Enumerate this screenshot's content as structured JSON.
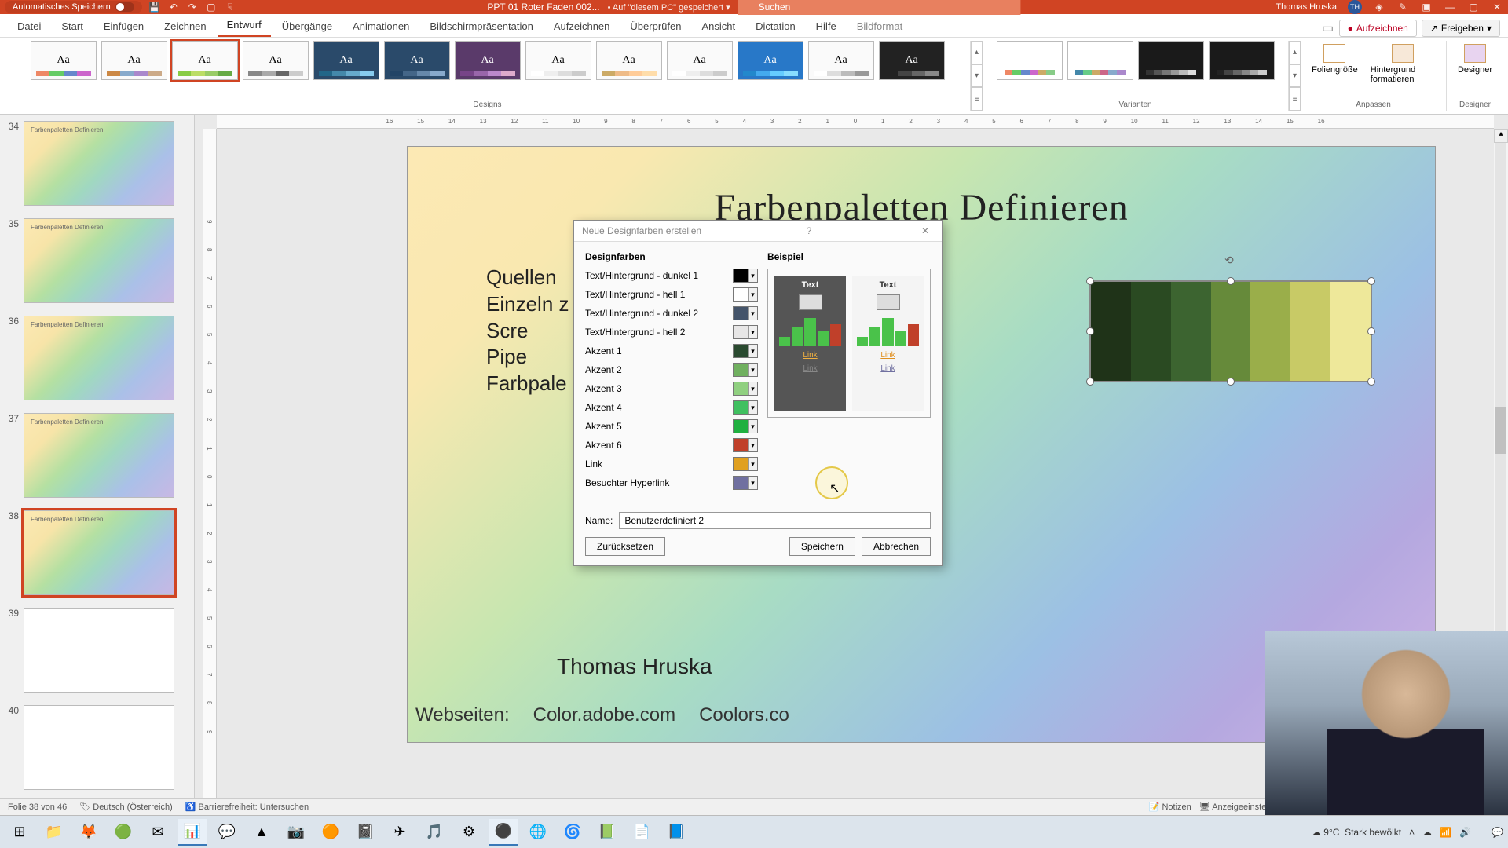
{
  "titlebar": {
    "autosave": "Automatisches Speichern",
    "filename": "PPT 01 Roter Faden 002...",
    "saved_hint": "Auf \"diesem PC\" gespeichert",
    "search_placeholder": "Suchen",
    "user_name": "Thomas Hruska",
    "user_initials": "TH"
  },
  "tabs": {
    "items": [
      "Datei",
      "Start",
      "Einfügen",
      "Zeichnen",
      "Entwurf",
      "Übergänge",
      "Animationen",
      "Bildschirmpräsentation",
      "Aufzeichnen",
      "Überprüfen",
      "Ansicht",
      "Dictation",
      "Hilfe",
      "Bildformat"
    ],
    "active": "Entwurf",
    "record": "Aufzeichnen",
    "share": "Freigeben"
  },
  "ribbon": {
    "group_designs": "Designs",
    "group_variants": "Varianten",
    "group_adjust": "Anpassen",
    "group_designer": "Designer",
    "btn_slide_size": "Foliengröße",
    "btn_format_bg": "Hintergrund formatieren",
    "btn_designer": "Designer"
  },
  "ruler_h": [
    "16",
    "15",
    "14",
    "13",
    "12",
    "11",
    "10",
    "9",
    "8",
    "7",
    "6",
    "5",
    "4",
    "3",
    "2",
    "1",
    "0",
    "1",
    "2",
    "3",
    "4",
    "5",
    "6",
    "7",
    "8",
    "9",
    "10",
    "11",
    "12",
    "13",
    "14",
    "15",
    "16"
  ],
  "ruler_v": [
    "9",
    "8",
    "7",
    "6",
    "5",
    "4",
    "3",
    "2",
    "1",
    "0",
    "1",
    "2",
    "3",
    "4",
    "5",
    "6",
    "7",
    "8",
    "9"
  ],
  "thumbs": [
    {
      "num": "34",
      "title": "Farbenpaletten Definieren"
    },
    {
      "num": "35",
      "title": "Farbenpaletten Definieren"
    },
    {
      "num": "36",
      "title": "Farbenpaletten Definieren"
    },
    {
      "num": "37",
      "title": "Farbenpaletten Definieren"
    },
    {
      "num": "38",
      "title": "Farbenpaletten Definieren",
      "selected": true
    },
    {
      "num": "39",
      "title": ""
    },
    {
      "num": "40",
      "title": ""
    }
  ],
  "slide": {
    "title": "Farbenpaletten Definieren",
    "body_lines": [
      "Quellen",
      "Einzeln z",
      "Scre",
      "Pipe",
      "Farbpale"
    ],
    "author": "Thomas Hruska",
    "site_label": "Webseiten:",
    "site1": "Color.adobe.com",
    "site2": "Coolors.co"
  },
  "palette_colors": [
    "#1f3318",
    "#2a4a22",
    "#3c6430",
    "#668a3a",
    "#9aae4a",
    "#c8ca66",
    "#eee89a"
  ],
  "dialog": {
    "title": "Neue Designfarben erstellen",
    "section_colors": "Designfarben",
    "section_preview": "Beispiel",
    "rows": [
      {
        "label": "Text/Hintergrund - dunkel 1",
        "u": "T",
        "color": "#000000"
      },
      {
        "label": "Text/Hintergrund - hell 1",
        "u": "H",
        "color": "#ffffff"
      },
      {
        "label": "Text/Hintergrund - dunkel 2",
        "u": "",
        "color": "#44546a"
      },
      {
        "label": "Text/Hintergrund - hell 2",
        "u": "e",
        "color": "#e7e6e6"
      },
      {
        "label": "Akzent 1",
        "u": "1",
        "color": "#2a4a30"
      },
      {
        "label": "Akzent 2",
        "u": "2",
        "color": "#70b060"
      },
      {
        "label": "Akzent 3",
        "u": "3",
        "color": "#90d080"
      },
      {
        "label": "Akzent 4",
        "u": "4",
        "color": "#40c060"
      },
      {
        "label": "Akzent 5",
        "u": "5",
        "color": "#20b040"
      },
      {
        "label": "Akzent 6",
        "u": "6",
        "color": "#c0402a"
      },
      {
        "label": "Link",
        "u": "k",
        "color": "#e0a020"
      },
      {
        "label": "Besuchter Hyperlink",
        "u": "B",
        "color": "#7070a0"
      }
    ],
    "preview_text": "Text",
    "preview_link": "Link",
    "name_label": "Name:",
    "name_value": "Benutzerdefiniert 2",
    "btn_reset": "Zurücksetzen",
    "btn_save": "Speichern",
    "btn_cancel": "Abbrechen"
  },
  "status": {
    "slide_pos": "Folie 38 von 46",
    "lang": "Deutsch (Österreich)",
    "access": "Barrierefreiheit: Untersuchen",
    "notes": "Notizen",
    "display": "Anzeigeeinstellungen"
  },
  "taskbar": {
    "weather_temp": "9°C",
    "weather_desc": "Stark bewölkt",
    "time": "",
    "date": ""
  }
}
